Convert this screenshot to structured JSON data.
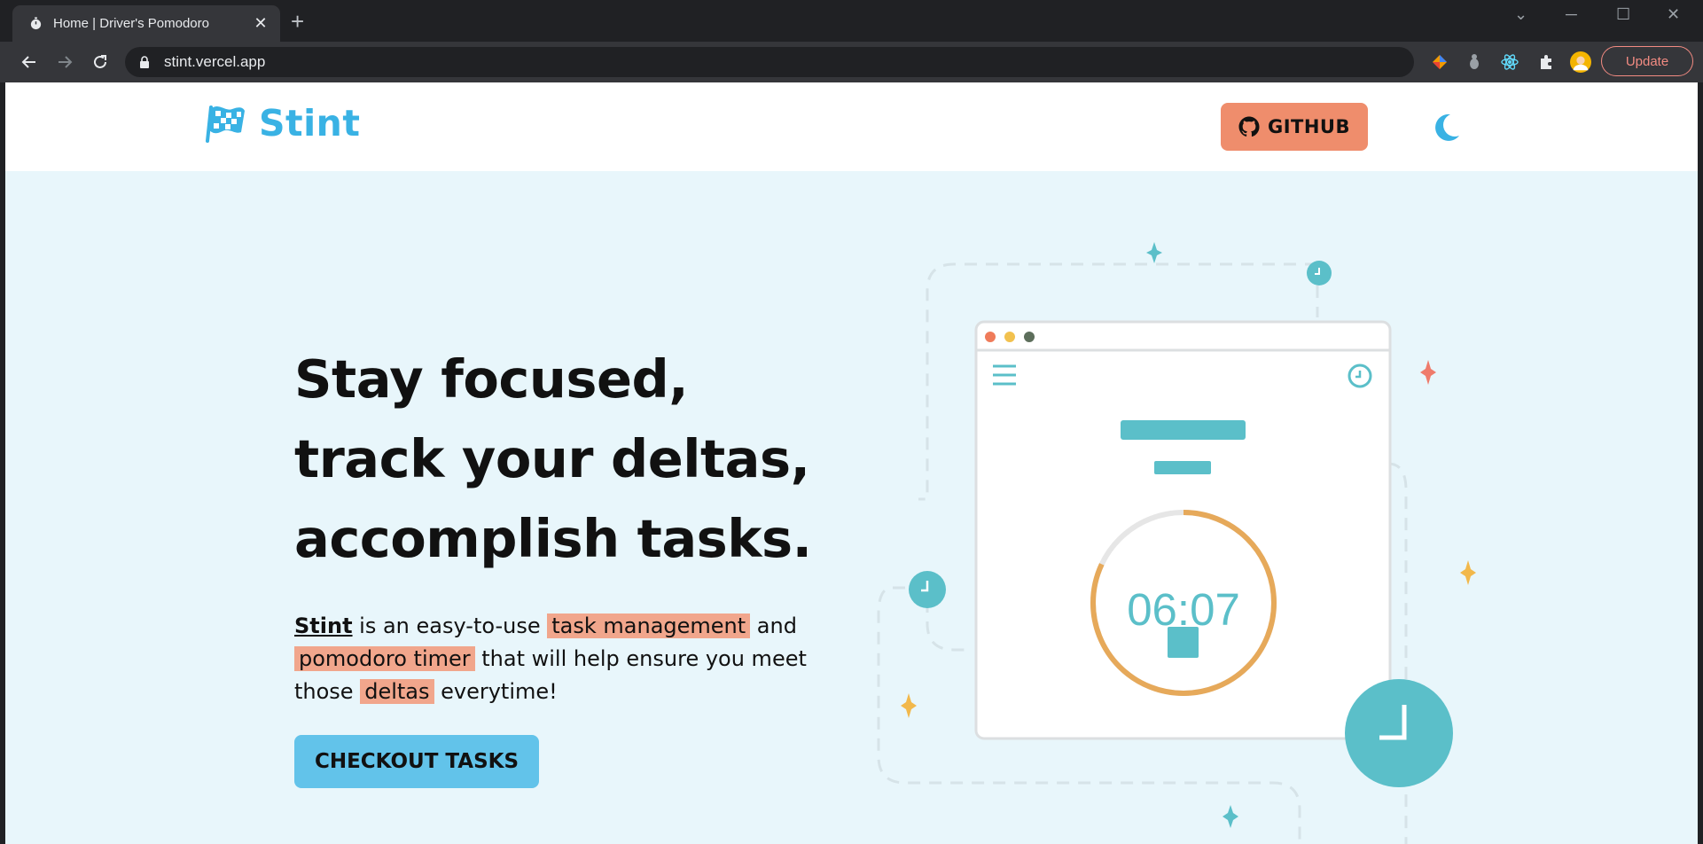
{
  "browser": {
    "tab_title": "Home | Driver's Pomodoro",
    "url": "stint.vercel.app",
    "update_label": "Update"
  },
  "site": {
    "brand": "Stint",
    "github_label": "GITHUB"
  },
  "hero": {
    "line1": "Stay focused,",
    "line2": "track your deltas,",
    "line3": "accomplish tasks.",
    "desc_brand": "Stint",
    "desc_t1": " is an easy-to-use ",
    "desc_hl1": "task management",
    "desc_t2": " and ",
    "desc_hl2": "pomodoro timer",
    "desc_t3": " that will help ensure you meet those ",
    "desc_hl3": "deltas",
    "desc_t4": " everytime!",
    "cta_label": "CHECKOUT TASKS"
  },
  "illustration": {
    "timer_text": "06:07",
    "timer_progress": 0.82
  },
  "colors": {
    "accent": "#39b2e4",
    "github_bg": "#ef8d6c",
    "highlight": "#f1a68c",
    "cta_bg": "#62c3ea",
    "teal": "#5bbfc9",
    "timer_orange": "#e6a95a",
    "page_bg": "#e8f6fb"
  }
}
